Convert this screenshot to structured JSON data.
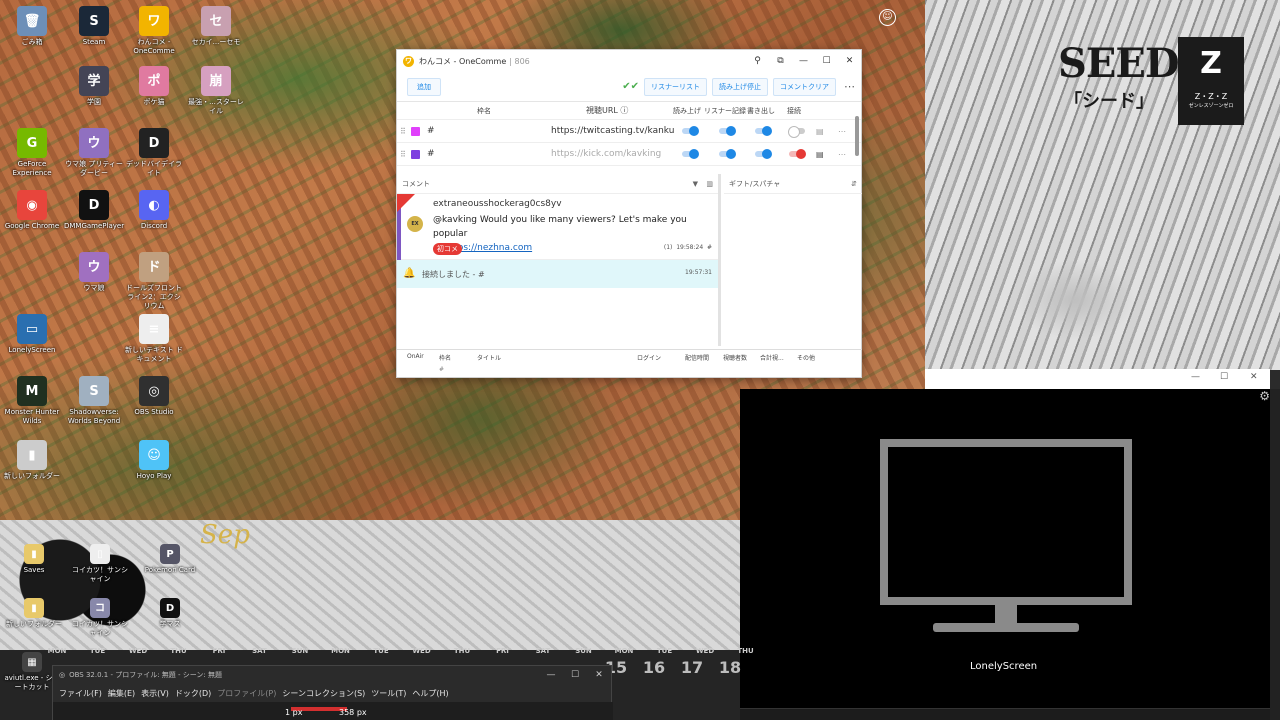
{
  "desktop_icons": [
    {
      "label": "ごみ箱",
      "color": "#6d8fb8",
      "glyph": "🗑"
    },
    {
      "label": "Steam",
      "color": "#1b2838",
      "glyph": "S"
    },
    {
      "label": "わんコメ - OneComme",
      "color": "#f2b400",
      "glyph": "ワ"
    },
    {
      "label": "セカイ...ーセモ",
      "color": "#c8a0b0",
      "glyph": "セ"
    },
    {
      "label": "学園",
      "color": "#445",
      "glyph": "学"
    },
    {
      "label": "ポケ猫",
      "color": "#e07aa0",
      "glyph": "ポ"
    },
    {
      "label": "最強・...スターレイル",
      "color": "#d6a0c0",
      "glyph": "崩"
    },
    {
      "label": "GeForce Experience",
      "color": "#76b900",
      "glyph": "G"
    },
    {
      "label": "ウマ娘 プリティーダービー",
      "color": "#9070c0",
      "glyph": "ウ"
    },
    {
      "label": "デッドバイデイライト",
      "color": "#222",
      "glyph": "D"
    },
    {
      "label": "Google Chrome",
      "color": "#e8453c",
      "glyph": "◉"
    },
    {
      "label": "DMMGamePlayer",
      "color": "#111",
      "glyph": "D"
    },
    {
      "label": "Discord",
      "color": "#5865f2",
      "glyph": "◐"
    },
    {
      "label": "ウマ娘",
      "color": "#a070c0",
      "glyph": "ウ"
    },
    {
      "label": "ドールズフロントライン2：エクシリウム",
      "color": "#c0a080",
      "glyph": "ド"
    },
    {
      "label": "LonelyScreen",
      "color": "#2a6fb0",
      "glyph": "▭"
    },
    {
      "label": "新しいテキスト ドキュメント",
      "color": "#eee",
      "glyph": "≡"
    },
    {
      "label": "Monster Hunter Wilds",
      "color": "#203020",
      "glyph": "M"
    },
    {
      "label": "Shadowverse: Worlds Beyond",
      "color": "#a0b0c0",
      "glyph": "S"
    },
    {
      "label": "OBS Studio",
      "color": "#303030",
      "glyph": "◎"
    },
    {
      "label": "新しいフォルダー",
      "color": "#ccc",
      "glyph": "▮"
    },
    {
      "label": "Hoyo Play",
      "color": "#4fc3f7",
      "glyph": "☺"
    }
  ],
  "desktop_icons_bottom": [
    {
      "label": "Saves",
      "color": "#e8c96a",
      "glyph": "▮"
    },
    {
      "label": "コイカツ！サンシャイン",
      "color": "#eee",
      "glyph": "▯"
    },
    {
      "label": "Pokemon Card",
      "color": "#556",
      "glyph": "P"
    },
    {
      "label": "新しいフォルダー",
      "color": "#e8c96a",
      "glyph": "▮"
    },
    {
      "label": "コイカツ！サンシャイン",
      "color": "#88a",
      "glyph": "コ"
    },
    {
      "label": "学マス",
      "color": "#111",
      "glyph": "D"
    },
    {
      "label": "aviutl.exe - ショートカット",
      "color": "#444",
      "glyph": "▦"
    }
  ],
  "onecomme": {
    "title": "わんコメ - OneComme",
    "version": "806",
    "add_button": "追加",
    "listener_list_button": "リスナーリスト",
    "stop_reading_button": "読み上げ停止",
    "clear_comments_button": "コメントクリア",
    "columns": {
      "name": "枠名",
      "url": "視聴URL",
      "read": "読み上げ",
      "listener": "リスナー記録",
      "write": "書き出し",
      "connect": "接続"
    },
    "streams": [
      {
        "name": "#",
        "url": "https://twitcasting.tv/kanku",
        "color": "#e040fb"
      },
      {
        "name": "#",
        "url": "https://kick.com/kavking",
        "color": "#7e3fe0"
      }
    ],
    "comment_pane_title": "コメント",
    "gift_pane_title": "ギフト/スパチャ",
    "comment": {
      "user": "extraneousshockerag0cs8yv",
      "avatar_text": "EX",
      "text": "@kavking Would you like many viewers? Let's make you popular",
      "link_prefix": "— ",
      "link": "https://nezhna.com",
      "badge": "初コメ",
      "count": "(1)",
      "time": "19:58:24",
      "hash": "#"
    },
    "system_message": {
      "text": "接続しました - #",
      "time": "19:57:31"
    },
    "bottom_columns": {
      "onair": "OnAir",
      "name": "枠名",
      "title": "タイトル",
      "login": "ログイン",
      "time": "配信時間",
      "viewers": "視聴者数",
      "total": "合計視...",
      "other": "その他"
    },
    "bottom_row": "#"
  },
  "lonelyscreen": {
    "label": "LonelyScreen"
  },
  "manga_logo": {
    "title": "SEED",
    "subtitle": "「シード」",
    "brand": "Z・Z・Z",
    "brand_sub": "ゼンレスゾーンゼロ"
  },
  "calendar": {
    "month_label": "Sep",
    "days": [
      "MON",
      "TUE",
      "WED",
      "THU",
      "FRI",
      "SAT",
      "SUN",
      "MON",
      "TUE",
      "WED",
      "THU",
      "FRI",
      "SAT",
      "SUN",
      "MON",
      "TUE",
      "WED",
      "THU"
    ],
    "visible_numbers": [
      "15",
      "16",
      "17",
      "18"
    ]
  },
  "obs": {
    "title": "OBS 32.0.1 - プロファイル: 無題 - シーン: 無題",
    "menu": [
      {
        "label": "ファイル(F)",
        "enabled": true
      },
      {
        "label": "編集(E)",
        "enabled": true
      },
      {
        "label": "表示(V)",
        "enabled": true
      },
      {
        "label": "ドック(D)",
        "enabled": true
      },
      {
        "label": "プロファイル(P)",
        "enabled": false
      },
      {
        "label": "シーンコレクション(S)",
        "enabled": true
      },
      {
        "label": "ツール(T)",
        "enabled": true
      },
      {
        "label": "ヘルプ(H)",
        "enabled": true
      }
    ],
    "size_left": "1 px",
    "size_right": "358 px"
  }
}
